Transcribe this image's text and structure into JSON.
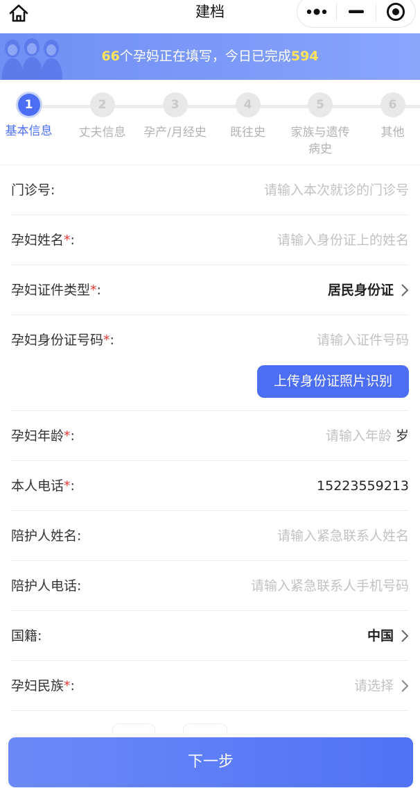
{
  "nav": {
    "title": "建档"
  },
  "banner": {
    "count": "66",
    "middle": "个孕妈正在填写，今日已完成",
    "done": "594"
  },
  "steps": [
    {
      "num": "1",
      "label": "基本信息"
    },
    {
      "num": "2",
      "label": "丈夫信息"
    },
    {
      "num": "3",
      "label": "孕产/月经史"
    },
    {
      "num": "4",
      "label": "既往史"
    },
    {
      "num": "5",
      "label": "家族与遗传病史"
    },
    {
      "num": "6",
      "label": "其他"
    }
  ],
  "form": {
    "clinic_no": {
      "label": "门诊号:",
      "placeholder": "请输入本次就诊的门诊号"
    },
    "name": {
      "label": "孕妇姓名",
      "req": "*",
      "colon": ":",
      "placeholder": "请输入身份证上的姓名"
    },
    "id_type": {
      "label": "孕妇证件类型",
      "req": "*",
      "colon": ":",
      "value": "居民身份证"
    },
    "id_no": {
      "label": "孕妇身份证号码",
      "req": "*",
      "colon": ":",
      "placeholder": "请输入证件号码",
      "upload": "上传身份证照片识别"
    },
    "age": {
      "label": "孕妇年龄",
      "req": "*",
      "colon": ":",
      "placeholder": "请输入年龄",
      "unit": "岁"
    },
    "phone": {
      "label": "本人电话",
      "req": "*",
      "colon": ":",
      "value": "15223559213"
    },
    "companion_name": {
      "label": "陪护人姓名:",
      "placeholder": "请输入紧急联系人姓名"
    },
    "companion_phone": {
      "label": "陪护人电话:",
      "placeholder": "请输入紧急联系人手机号码"
    },
    "nationality": {
      "label": "国籍:",
      "value": "中国"
    },
    "ethnicity": {
      "label": "孕妇民族",
      "req": "*",
      "colon": ":",
      "placeholder": "请选择"
    }
  },
  "next_button": "下一步"
}
